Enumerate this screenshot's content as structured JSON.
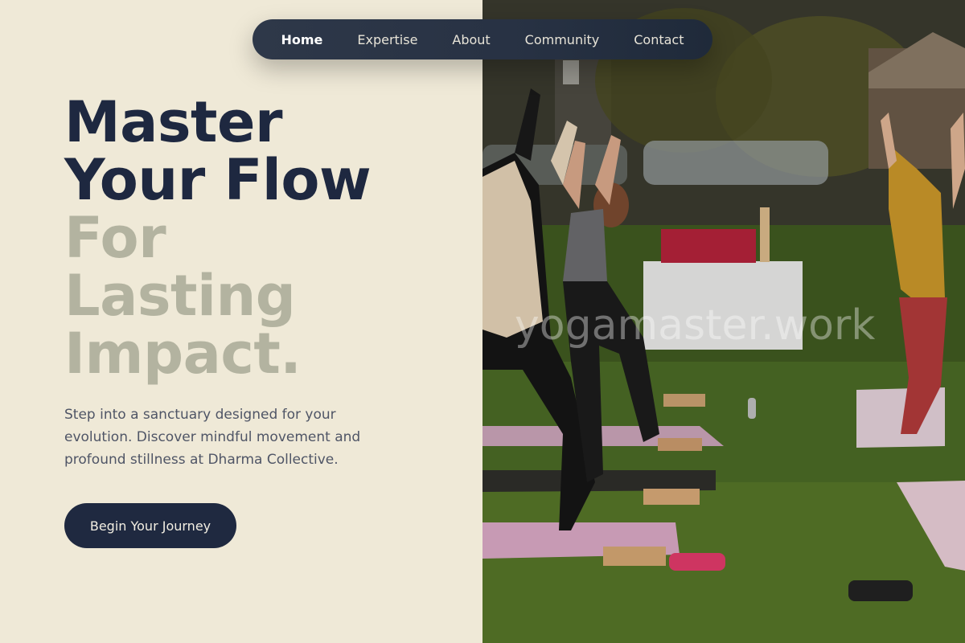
{
  "nav": {
    "items": [
      {
        "label": "Home",
        "active": true
      },
      {
        "label": "Expertise",
        "active": false
      },
      {
        "label": "About",
        "active": false
      },
      {
        "label": "Community",
        "active": false
      },
      {
        "label": "Contact",
        "active": false
      }
    ]
  },
  "hero": {
    "headline_dark": [
      "Master",
      "Your Flow"
    ],
    "headline_muted": [
      "For",
      "Lasting",
      "Impact."
    ],
    "subtext": "Step into a sanctuary designed for your evolution. Discover mindful movement and profound stillness at Dharma Collective.",
    "cta_label": "Begin Your Journey",
    "image_watermark": "yogamaster.work"
  },
  "colors": {
    "background": "#efe9d7",
    "headline_dark": "#1e2840",
    "headline_muted": "#b3b3a0",
    "nav_bg": "#283244",
    "cta_bg": "#1f2940"
  }
}
